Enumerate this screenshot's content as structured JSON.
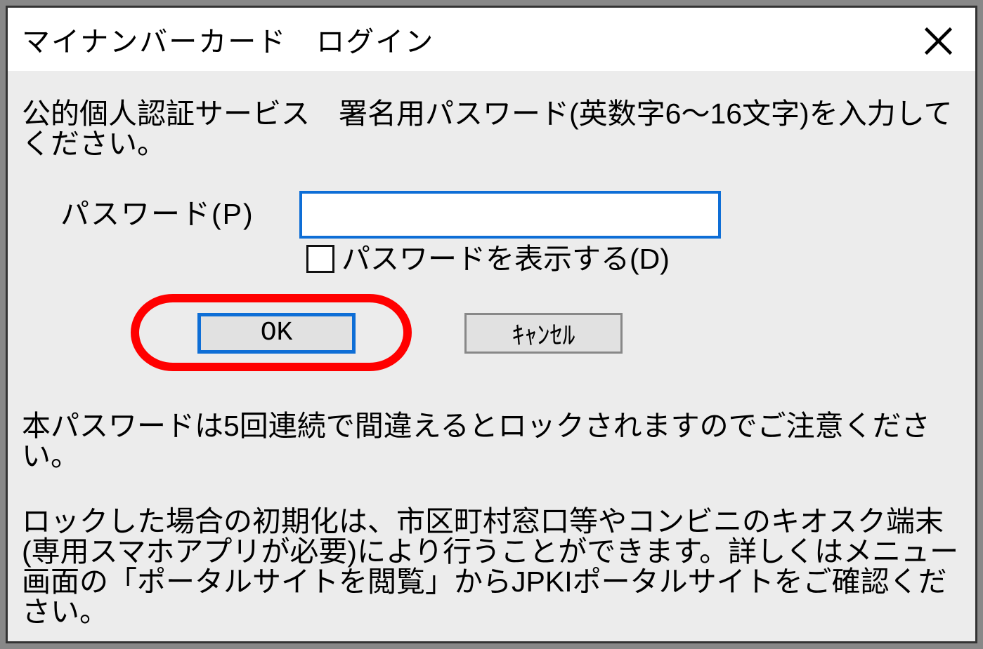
{
  "dialog": {
    "title": "マイナンバーカード　ログイン",
    "instruction": "公的個人認証サービス　署名用パスワード(英数字6～16文字)を入力してください。",
    "password_label": "パスワード(P)",
    "password_value": "",
    "show_password_label": "パスワードを表示する(D)",
    "ok_label": "OK",
    "cancel_label": "ｷｬﾝｾﾙ",
    "warning": "本パスワードは5回連続で間違えるとロックされますのでご注意ください。",
    "info": "ロックした場合の初期化は、市区町村窓口等やコンビニのキオスク端末(専用スマホアプリが必要)により行うことができます。詳しくはメニュー画面の「ポータルサイトを閲覧」からJPKIポータルサイトをご確認ください。"
  }
}
